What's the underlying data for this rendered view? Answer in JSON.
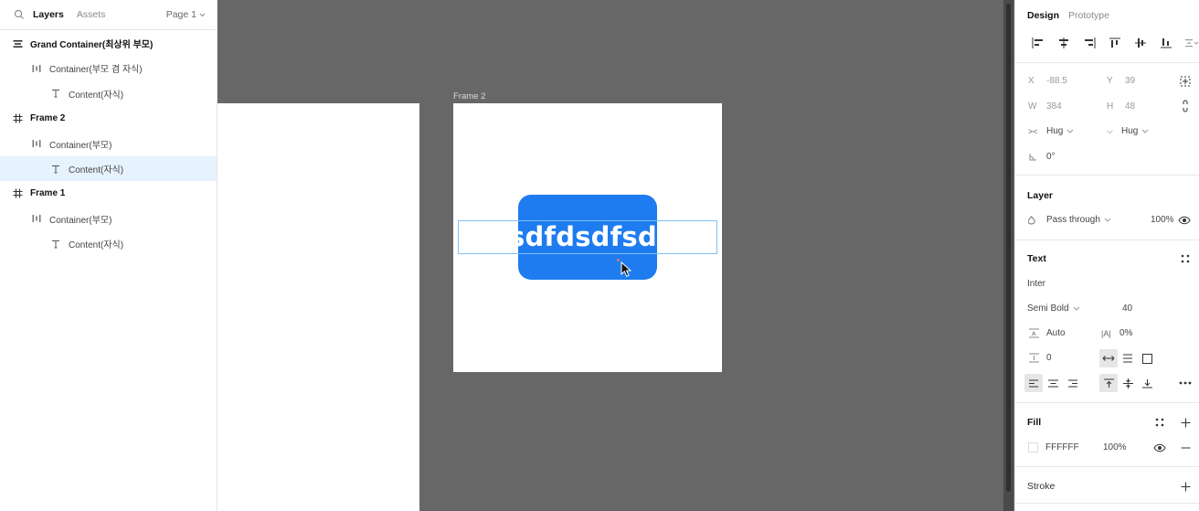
{
  "left_panel": {
    "tabs": {
      "layers": "Layers",
      "assets": "Assets"
    },
    "page_select": "Page 1",
    "layers": [
      {
        "name": "Grand Container(최상위 부모)",
        "icon": "autolayout-vertical-icon",
        "level": 0,
        "bold": true,
        "selected": false
      },
      {
        "name": "Container(부모 겸 자식)",
        "icon": "autolayout-horizontal-icon",
        "level": 1,
        "bold": false,
        "selected": false
      },
      {
        "name": "Content(자식)",
        "icon": "text-icon",
        "level": 2,
        "bold": false,
        "selected": false
      },
      {
        "name": "Frame 2",
        "icon": "frame-icon",
        "level": 0,
        "bold": true,
        "selected": false
      },
      {
        "name": "Container(부모)",
        "icon": "autolayout-horizontal-icon",
        "level": 1,
        "bold": false,
        "selected": false
      },
      {
        "name": "Content(자식)",
        "icon": "text-icon",
        "level": 2,
        "bold": false,
        "selected": true
      },
      {
        "name": "Frame 1",
        "icon": "frame-icon",
        "level": 0,
        "bold": true,
        "selected": false
      },
      {
        "name": "Container(부모)",
        "icon": "autolayout-horizontal-icon",
        "level": 1,
        "bold": false,
        "selected": false
      },
      {
        "name": "Content(자식)",
        "icon": "text-icon",
        "level": 2,
        "bold": false,
        "selected": false
      }
    ]
  },
  "canvas": {
    "frame_label": "Frame 2",
    "content_text": "sdfdsdfsdsfsdf",
    "accent_color": "#1E7CF0",
    "selection_color": "#7FC0F6"
  },
  "right_panel": {
    "tabs": {
      "design": "Design",
      "prototype": "Prototype"
    },
    "position": {
      "x_label": "X",
      "x": "-88.5",
      "y_label": "Y",
      "y": "39"
    },
    "size": {
      "w_label": "W",
      "w": "384",
      "h_label": "H",
      "h": "48"
    },
    "resizing": {
      "horizontal": "Hug",
      "vertical": "Hug"
    },
    "rotation": "0°",
    "layer": {
      "title": "Layer",
      "blend": "Pass through",
      "opacity": "100%"
    },
    "text": {
      "title": "Text",
      "font_family": "Inter",
      "font_weight": "Semi Bold",
      "font_size": "40",
      "line_height": "Auto",
      "letter_spacing": "0%",
      "paragraph_spacing": "0"
    },
    "fill": {
      "title": "Fill",
      "hex": "FFFFFF",
      "opacity": "100%"
    },
    "stroke": {
      "title": "Stroke"
    }
  }
}
